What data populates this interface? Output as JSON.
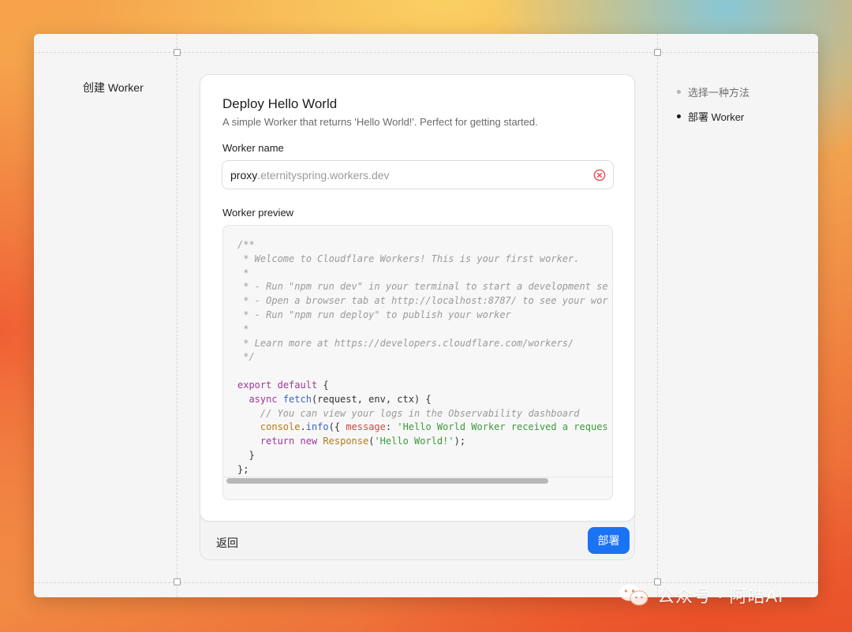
{
  "page": {
    "heading": "创建 Worker"
  },
  "steps": [
    {
      "label": "选择一种方法",
      "state": "done"
    },
    {
      "label": "部署 Worker",
      "state": "current"
    }
  ],
  "card": {
    "title": "Deploy Hello World",
    "description": "A simple Worker that returns 'Hello World!'. Perfect for getting started.",
    "name_label": "Worker name",
    "name_value": "proxy",
    "name_suffix": ".eternityspring.workers.dev",
    "preview_label": "Worker preview",
    "code_lines": [
      "/**",
      " * Welcome to Cloudflare Workers! This is your first worker.",
      " *",
      " * - Run \"npm run dev\" in your terminal to start a development se",
      " * - Open a browser tab at http://localhost:8787/ to see your wor",
      " * - Run \"npm run deploy\" to publish your worker",
      " *",
      " * Learn more at https://developers.cloudflare.com/workers/",
      " */",
      "",
      "export default {",
      "  async fetch(request, env, ctx) {",
      "    // You can view your logs in the Observability dashboard",
      "    console.info({ message: 'Hello World Worker received a reques",
      "    return new Response('Hello World!');",
      "  }",
      "};"
    ]
  },
  "footer": {
    "back_label": "返回",
    "deploy_label": "部署"
  },
  "watermark": {
    "text": "公众号 · 阿皓AI"
  },
  "colors": {
    "accent": "#1a73f5",
    "clear_icon": "#e5484d"
  },
  "icons": {
    "clear": "clear-circle-x-icon",
    "wechat": "wechat-icon"
  }
}
